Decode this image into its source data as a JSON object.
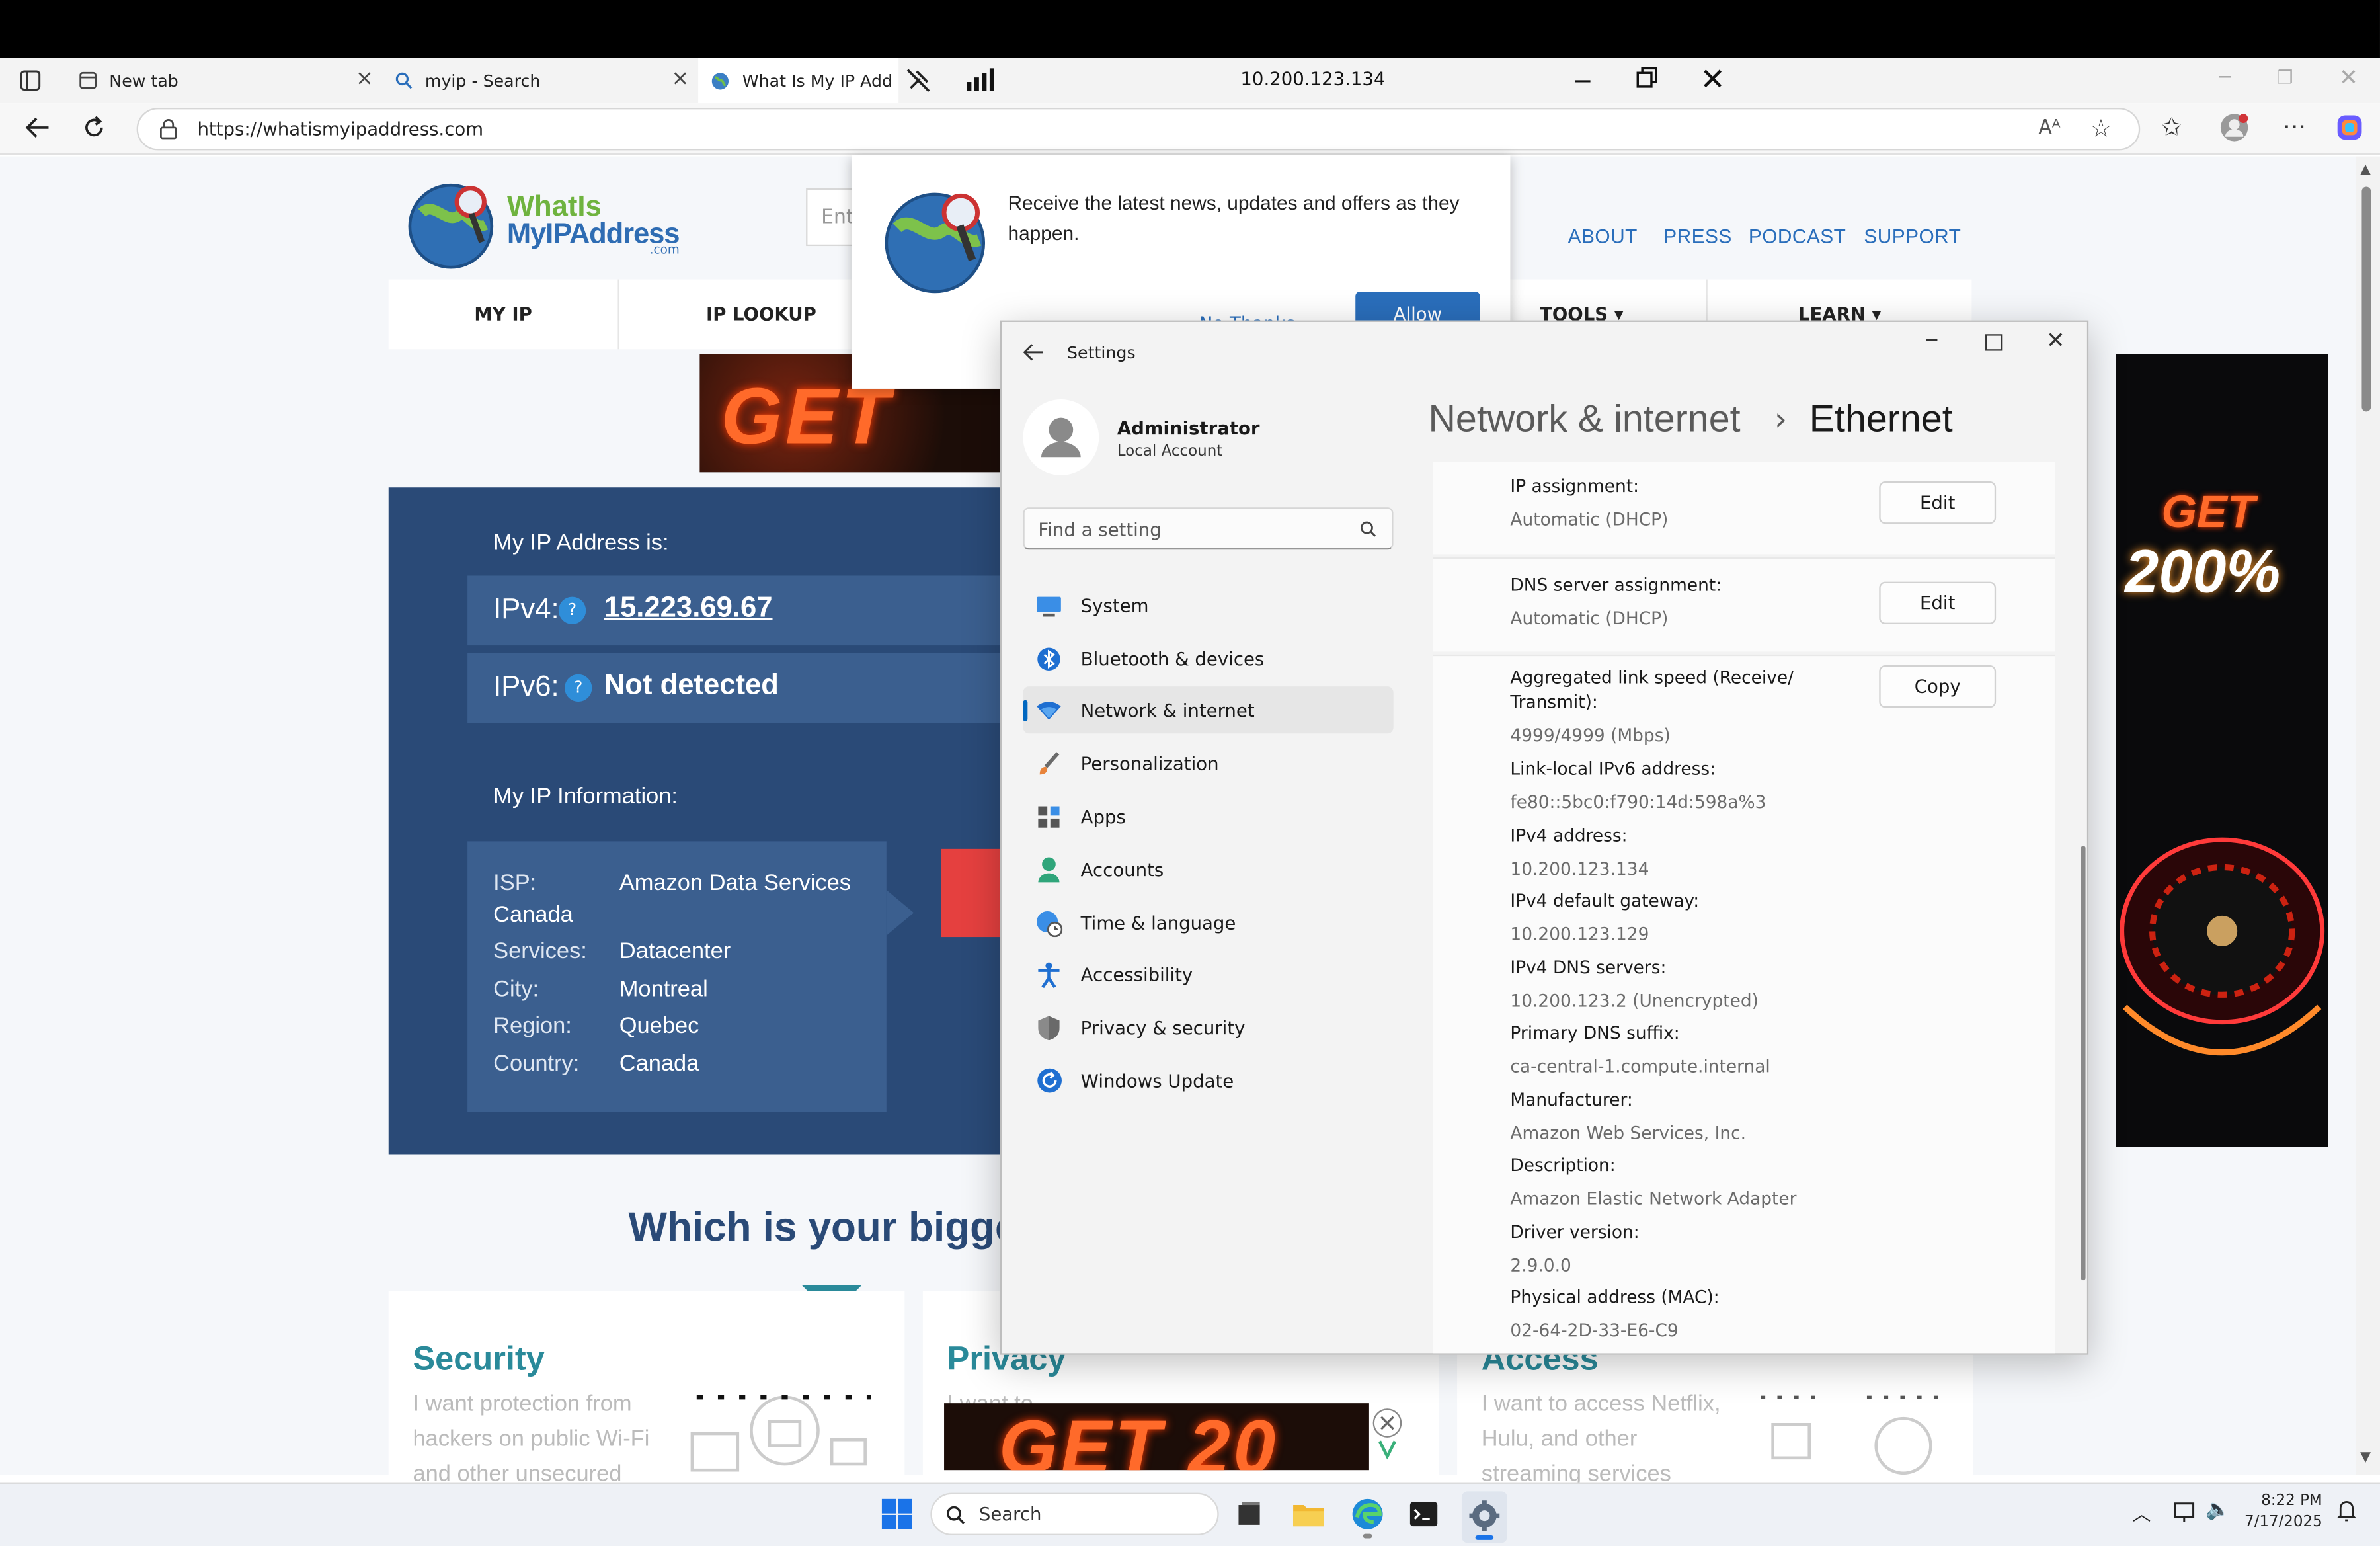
{
  "browser": {
    "tabs": [
      {
        "label": "New tab"
      },
      {
        "label": "myip - Search"
      },
      {
        "label": "What Is My IP Add"
      }
    ],
    "remote_host": "10.200.123.134",
    "url": "https://whatismyipaddress.com"
  },
  "site": {
    "logo": {
      "line1": "WhatIs",
      "line2": "MyIPAddress",
      "suffix": ".com"
    },
    "search_placeholder": "Ent",
    "top_links": [
      "ABOUT",
      "PRESS",
      "PODCAST",
      "SUPPORT"
    ],
    "menu": [
      "MY IP",
      "IP LOOKUP",
      "TOOLS ▾",
      "LEARN ▾"
    ],
    "ip_heading": "My IP Address is:",
    "ipv4_label": "IPv4:",
    "ipv4_value": "15.223.69.67",
    "ipv6_label": "IPv6:",
    "ipv6_value": "Not detected",
    "help_glyph": "?",
    "info_heading": "My IP Information:",
    "info": {
      "isp_key": "ISP:",
      "isp_val": "Amazon Data Services",
      "isp_extra": "Canada",
      "services_key": "Services:",
      "services_val": "Datacenter",
      "city_key": "City:",
      "city_val": "Montreal",
      "region_key": "Region:",
      "region_val": "Quebec",
      "country_key": "Country:",
      "country_val": "Canada"
    },
    "question_heading": "Which is your bigge",
    "features": [
      {
        "title": "Security",
        "text1": "I want protection from",
        "text2": "hackers on public Wi-Fi",
        "text3": "and other unsecured"
      },
      {
        "title": "Privacy",
        "text1": "I want to ...",
        "text2": "",
        "text3": ""
      },
      {
        "title": "Access",
        "text1": "I want to access Netflix,",
        "text2": "Hulu, and other",
        "text3": "streaming services"
      }
    ],
    "banner_text": "GET 20",
    "bottom_ad_text": "GET 20",
    "right_ad": {
      "line1": "GET",
      "line2": "200%"
    }
  },
  "notification": {
    "text": "Receive the latest news, updates and offers as they happen.",
    "later_button": "No Thanks",
    "allow_button": "Allow"
  },
  "settings": {
    "window_title": "Settings",
    "user_name": "Administrator",
    "user_type": "Local Account",
    "search_placeholder": "Find a setting",
    "breadcrumb_parent": "Network & internet",
    "breadcrumb_sep": "›",
    "breadcrumb_current": "Ethernet",
    "nav": [
      {
        "label": "System",
        "icon": "system-icon"
      },
      {
        "label": "Bluetooth & devices",
        "icon": "bluetooth-icon"
      },
      {
        "label": "Network & internet",
        "icon": "wifi-icon",
        "selected": true
      },
      {
        "label": "Personalization",
        "icon": "brush-icon"
      },
      {
        "label": "Apps",
        "icon": "apps-icon"
      },
      {
        "label": "Accounts",
        "icon": "person-icon"
      },
      {
        "label": "Time & language",
        "icon": "globe-clock-icon"
      },
      {
        "label": "Accessibility",
        "icon": "accessibility-icon"
      },
      {
        "label": "Privacy & security",
        "icon": "shield-icon"
      },
      {
        "label": "Windows Update",
        "icon": "update-icon"
      }
    ],
    "ip_assignment_label": "IP assignment:",
    "ip_assignment_value": "Automatic (DHCP)",
    "dns_assignment_label": "DNS server assignment:",
    "dns_assignment_value": "Automatic (DHCP)",
    "edit_label": "Edit",
    "copy_label": "Copy",
    "props": [
      {
        "label": "Aggregated link speed (Receive/",
        "label2": "Transmit):",
        "value": "4999/4999 (Mbps)"
      },
      {
        "label": "Link-local IPv6 address:",
        "value": "fe80::5bc0:f790:14d:598a%3"
      },
      {
        "label": "IPv4 address:",
        "value": "10.200.123.134"
      },
      {
        "label": "IPv4 default gateway:",
        "value": "10.200.123.129"
      },
      {
        "label": "IPv4 DNS servers:",
        "value": "10.200.123.2 (Unencrypted)"
      },
      {
        "label": "Primary DNS suffix:",
        "value": "ca-central-1.compute.internal"
      },
      {
        "label": "Manufacturer:",
        "value": "Amazon Web Services, Inc."
      },
      {
        "label": "Description:",
        "value": "Amazon Elastic Network Adapter"
      },
      {
        "label": "Driver version:",
        "value": "2.9.0.0"
      },
      {
        "label": "Physical address (MAC):",
        "value": "02-64-2D-33-E6-C9"
      }
    ]
  },
  "taskbar": {
    "search_placeholder": "Search",
    "time": "8:22 PM",
    "date": "7/17/2025"
  },
  "colors": {
    "ip_card": "#2a4a77",
    "link_blue": "#2a6ebb",
    "accent": "#0067c0",
    "feature_teal": "#2a8a9a"
  }
}
